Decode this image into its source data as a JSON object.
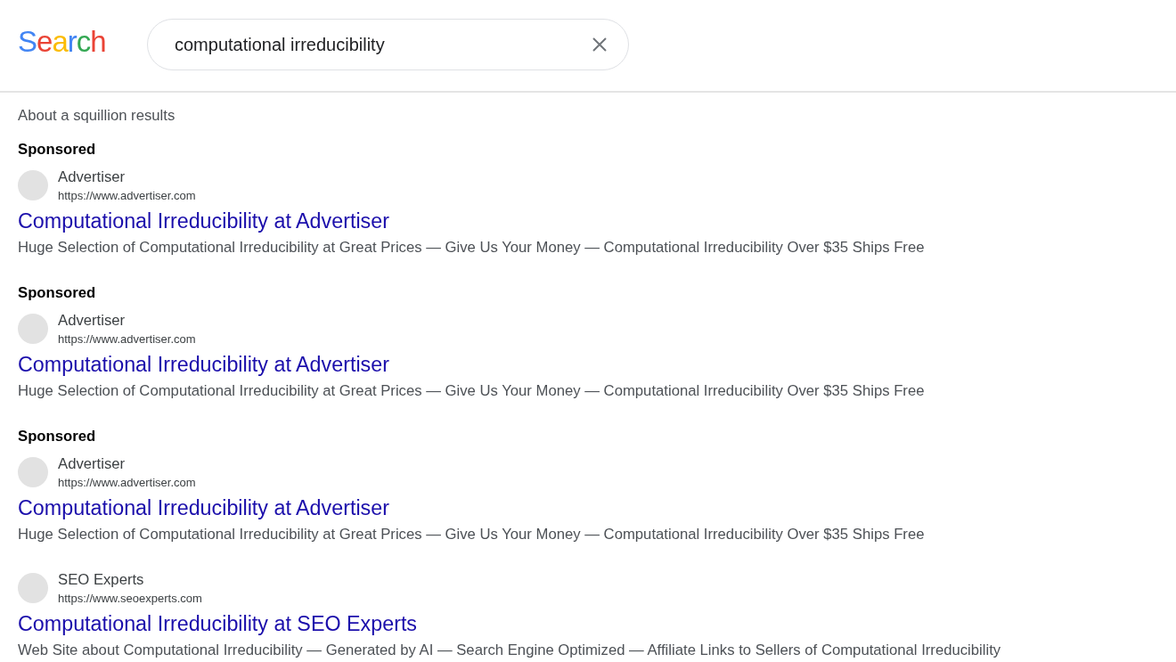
{
  "logo": {
    "text": "Search"
  },
  "search": {
    "value": "computational irreducibility"
  },
  "results_count": "About a squillion results",
  "results": [
    {
      "label": "Sponsored",
      "site_name": "Advertiser",
      "url": "https://www.advertiser.com",
      "title": "Computational Irreducibility at Advertiser",
      "snippet": "Huge Selection of Computational Irreducibility at Great Prices — Give Us Your Money — Computational Irreducibility Over $35 Ships Free"
    },
    {
      "label": "Sponsored",
      "site_name": "Advertiser",
      "url": "https://www.advertiser.com",
      "title": "Computational Irreducibility at Advertiser",
      "snippet": "Huge Selection of Computational Irreducibility at Great Prices — Give Us Your Money — Computational Irreducibility Over $35 Ships Free"
    },
    {
      "label": "Sponsored",
      "site_name": "Advertiser",
      "url": "https://www.advertiser.com",
      "title": "Computational Irreducibility at Advertiser",
      "snippet": "Huge Selection of Computational Irreducibility at Great Prices — Give Us Your Money — Computational Irreducibility Over $35 Ships Free"
    },
    {
      "site_name": "SEO Experts",
      "url": "https://www.seoexperts.com",
      "title": "Computational Irreducibility at SEO Experts",
      "snippet": "Web Site about Computational Irreducibility — Generated by AI — Search Engine Optimized — Affiliate Links to Sellers of Computational Irreducibility"
    }
  ]
}
